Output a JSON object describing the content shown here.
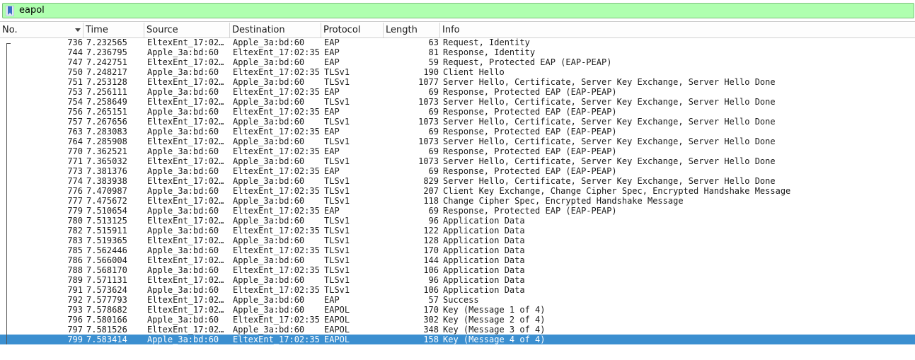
{
  "filter": {
    "value": "eapol",
    "icon": "bookmark-icon",
    "background_color": "#afffaf"
  },
  "columns": [
    "No.",
    "Time",
    "Source",
    "Destination",
    "Protocol",
    "Length",
    "Info"
  ],
  "selected_color": "#3b8fd0",
  "packets": [
    {
      "no": "736",
      "time": "7.232565",
      "source": "EltexEnt_17:02…",
      "destination": "Apple_3a:bd:60",
      "protocol": "EAP",
      "length": "63",
      "info": "Request, Identity"
    },
    {
      "no": "744",
      "time": "7.236795",
      "source": "Apple_3a:bd:60",
      "destination": "EltexEnt_17:02:35",
      "protocol": "EAP",
      "length": "81",
      "info": "Response, Identity"
    },
    {
      "no": "747",
      "time": "7.242751",
      "source": "EltexEnt_17:02…",
      "destination": "Apple_3a:bd:60",
      "protocol": "EAP",
      "length": "59",
      "info": "Request, Protected EAP (EAP-PEAP)"
    },
    {
      "no": "750",
      "time": "7.248217",
      "source": "Apple_3a:bd:60",
      "destination": "EltexEnt_17:02:35",
      "protocol": "TLSv1",
      "length": "190",
      "info": "Client Hello"
    },
    {
      "no": "751",
      "time": "7.253128",
      "source": "EltexEnt_17:02…",
      "destination": "Apple_3a:bd:60",
      "protocol": "TLSv1",
      "length": "1077",
      "info": "Server Hello, Certificate, Server Key Exchange, Server Hello Done"
    },
    {
      "no": "753",
      "time": "7.256111",
      "source": "Apple_3a:bd:60",
      "destination": "EltexEnt_17:02:35",
      "protocol": "EAP",
      "length": "69",
      "info": "Response, Protected EAP (EAP-PEAP)"
    },
    {
      "no": "754",
      "time": "7.258649",
      "source": "EltexEnt_17:02…",
      "destination": "Apple_3a:bd:60",
      "protocol": "TLSv1",
      "length": "1073",
      "info": "Server Hello, Certificate, Server Key Exchange, Server Hello Done"
    },
    {
      "no": "756",
      "time": "7.265151",
      "source": "Apple_3a:bd:60",
      "destination": "EltexEnt_17:02:35",
      "protocol": "EAP",
      "length": "69",
      "info": "Response, Protected EAP (EAP-PEAP)"
    },
    {
      "no": "757",
      "time": "7.267656",
      "source": "EltexEnt_17:02…",
      "destination": "Apple_3a:bd:60",
      "protocol": "TLSv1",
      "length": "1073",
      "info": "Server Hello, Certificate, Server Key Exchange, Server Hello Done"
    },
    {
      "no": "763",
      "time": "7.283083",
      "source": "Apple_3a:bd:60",
      "destination": "EltexEnt_17:02:35",
      "protocol": "EAP",
      "length": "69",
      "info": "Response, Protected EAP (EAP-PEAP)"
    },
    {
      "no": "764",
      "time": "7.285908",
      "source": "EltexEnt_17:02…",
      "destination": "Apple_3a:bd:60",
      "protocol": "TLSv1",
      "length": "1073",
      "info": "Server Hello, Certificate, Server Key Exchange, Server Hello Done"
    },
    {
      "no": "770",
      "time": "7.362521",
      "source": "Apple_3a:bd:60",
      "destination": "EltexEnt_17:02:35",
      "protocol": "EAP",
      "length": "69",
      "info": "Response, Protected EAP (EAP-PEAP)"
    },
    {
      "no": "771",
      "time": "7.365032",
      "source": "EltexEnt_17:02…",
      "destination": "Apple_3a:bd:60",
      "protocol": "TLSv1",
      "length": "1073",
      "info": "Server Hello, Certificate, Server Key Exchange, Server Hello Done"
    },
    {
      "no": "773",
      "time": "7.381376",
      "source": "Apple_3a:bd:60",
      "destination": "EltexEnt_17:02:35",
      "protocol": "EAP",
      "length": "69",
      "info": "Response, Protected EAP (EAP-PEAP)"
    },
    {
      "no": "774",
      "time": "7.383938",
      "source": "EltexEnt_17:02…",
      "destination": "Apple_3a:bd:60",
      "protocol": "TLSv1",
      "length": "829",
      "info": "Server Hello, Certificate, Server Key Exchange, Server Hello Done"
    },
    {
      "no": "776",
      "time": "7.470987",
      "source": "Apple_3a:bd:60",
      "destination": "EltexEnt_17:02:35",
      "protocol": "TLSv1",
      "length": "207",
      "info": "Client Key Exchange, Change Cipher Spec, Encrypted Handshake Message"
    },
    {
      "no": "777",
      "time": "7.475672",
      "source": "EltexEnt_17:02…",
      "destination": "Apple_3a:bd:60",
      "protocol": "TLSv1",
      "length": "118",
      "info": "Change Cipher Spec, Encrypted Handshake Message"
    },
    {
      "no": "779",
      "time": "7.510654",
      "source": "Apple_3a:bd:60",
      "destination": "EltexEnt_17:02:35",
      "protocol": "EAP",
      "length": "69",
      "info": "Response, Protected EAP (EAP-PEAP)"
    },
    {
      "no": "780",
      "time": "7.513125",
      "source": "EltexEnt_17:02…",
      "destination": "Apple_3a:bd:60",
      "protocol": "TLSv1",
      "length": "96",
      "info": "Application Data"
    },
    {
      "no": "782",
      "time": "7.515911",
      "source": "Apple_3a:bd:60",
      "destination": "EltexEnt_17:02:35",
      "protocol": "TLSv1",
      "length": "122",
      "info": "Application Data"
    },
    {
      "no": "783",
      "time": "7.519365",
      "source": "EltexEnt_17:02…",
      "destination": "Apple_3a:bd:60",
      "protocol": "TLSv1",
      "length": "128",
      "info": "Application Data"
    },
    {
      "no": "785",
      "time": "7.562446",
      "source": "Apple_3a:bd:60",
      "destination": "EltexEnt_17:02:35",
      "protocol": "TLSv1",
      "length": "170",
      "info": "Application Data"
    },
    {
      "no": "786",
      "time": "7.566004",
      "source": "EltexEnt_17:02…",
      "destination": "Apple_3a:bd:60",
      "protocol": "TLSv1",
      "length": "144",
      "info": "Application Data"
    },
    {
      "no": "788",
      "time": "7.568170",
      "source": "Apple_3a:bd:60",
      "destination": "EltexEnt_17:02:35",
      "protocol": "TLSv1",
      "length": "106",
      "info": "Application Data"
    },
    {
      "no": "789",
      "time": "7.571131",
      "source": "EltexEnt_17:02…",
      "destination": "Apple_3a:bd:60",
      "protocol": "TLSv1",
      "length": "96",
      "info": "Application Data"
    },
    {
      "no": "791",
      "time": "7.573624",
      "source": "Apple_3a:bd:60",
      "destination": "EltexEnt_17:02:35",
      "protocol": "TLSv1",
      "length": "106",
      "info": "Application Data"
    },
    {
      "no": "792",
      "time": "7.577793",
      "source": "EltexEnt_17:02…",
      "destination": "Apple_3a:bd:60",
      "protocol": "EAP",
      "length": "57",
      "info": "Success"
    },
    {
      "no": "793",
      "time": "7.578682",
      "source": "EltexEnt_17:02…",
      "destination": "Apple_3a:bd:60",
      "protocol": "EAPOL",
      "length": "170",
      "info": "Key (Message 1 of 4)"
    },
    {
      "no": "796",
      "time": "7.580166",
      "source": "Apple_3a:bd:60",
      "destination": "EltexEnt_17:02:35",
      "protocol": "EAPOL",
      "length": "302",
      "info": "Key (Message 2 of 4)"
    },
    {
      "no": "797",
      "time": "7.581526",
      "source": "EltexEnt_17:02…",
      "destination": "Apple_3a:bd:60",
      "protocol": "EAPOL",
      "length": "348",
      "info": "Key (Message 3 of 4)"
    },
    {
      "no": "799",
      "time": "7.583414",
      "source": "Apple_3a:bd:60",
      "destination": "EltexEnt_17:02:35",
      "protocol": "EAPOL",
      "length": "158",
      "info": "Key (Message 4 of 4)",
      "selected": true
    }
  ]
}
